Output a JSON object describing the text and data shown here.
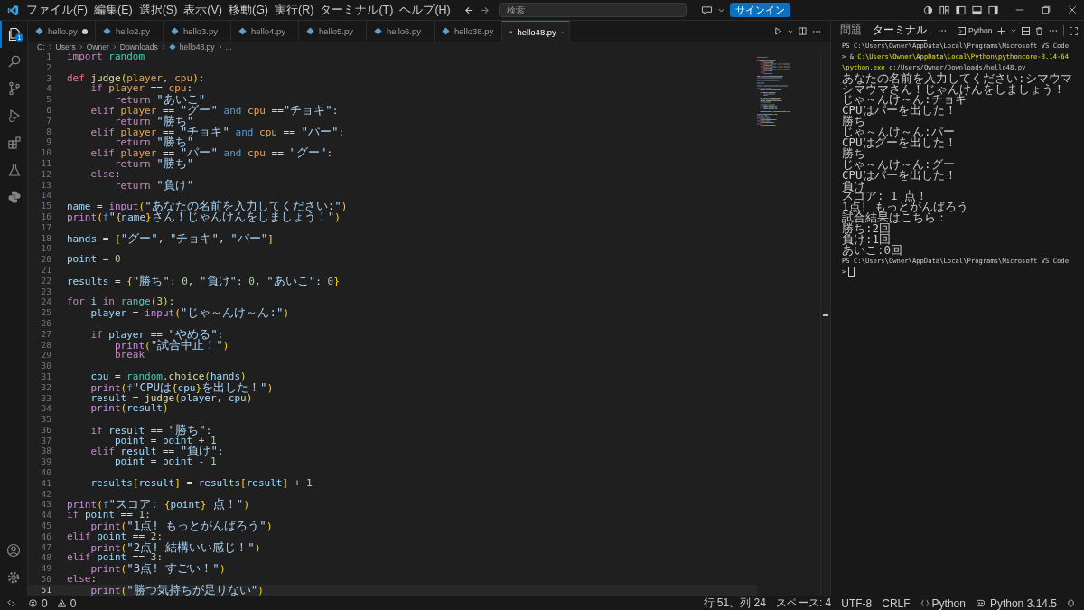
{
  "menu": [
    "ファイル(F)",
    "編集(E)",
    "選択(S)",
    "表示(V)",
    "移動(G)",
    "実行(R)",
    "ターミナル(T)",
    "ヘルプ(H)"
  ],
  "search": {
    "placeholder": "検索"
  },
  "signin_button": "サインイン",
  "activity_bar": {
    "items": [
      {
        "kind": "explorer",
        "selected": true,
        "badge": "1"
      },
      {
        "kind": "search",
        "selected": false
      },
      {
        "kind": "scm",
        "selected": false
      },
      {
        "kind": "debug",
        "selected": false
      },
      {
        "kind": "extensions",
        "selected": false
      },
      {
        "kind": "testing",
        "selected": false
      },
      {
        "kind": "python",
        "selected": false
      }
    ]
  },
  "tabs": [
    {
      "label": "hello.py",
      "selected": false,
      "modified": true
    },
    {
      "label": "hello2.py",
      "selected": false,
      "modified": false
    },
    {
      "label": "hello3.py",
      "selected": false,
      "modified": false
    },
    {
      "label": "hello4.py",
      "selected": false,
      "modified": false
    },
    {
      "label": "hello5.py",
      "selected": false,
      "modified": false
    },
    {
      "label": "hello6.py",
      "selected": false,
      "modified": false
    },
    {
      "label": "hello38.py",
      "selected": false,
      "modified": false
    },
    {
      "label": "hello48.py",
      "selected": true,
      "modified": false
    }
  ],
  "breadcrumb": [
    {
      "kind": "folder",
      "text": "C:"
    },
    {
      "kind": "folder",
      "text": "Users"
    },
    {
      "kind": "folder",
      "text": "Owner"
    },
    {
      "kind": "folder",
      "text": "Downloads"
    },
    {
      "kind": "file",
      "text": "hello48.py"
    },
    {
      "kind": "more",
      "text": "..."
    }
  ],
  "editor": {
    "lines": [
      {
        "number": "1",
        "current": false,
        "tokens": [
          {
            "kind": "kw",
            "text": "import "
          },
          {
            "kind": "cls",
            "text": "random"
          }
        ]
      },
      {
        "number": "2",
        "current": false
      },
      {
        "number": "3",
        "current": false,
        "tokens": [
          {
            "kind": "def",
            "text": "def "
          },
          {
            "kind": "fn",
            "text": "judge"
          },
          {
            "kind": "br",
            "text": "("
          },
          {
            "kind": "param",
            "text": "player"
          },
          {
            "kind": "op",
            "text": ", "
          },
          {
            "kind": "param",
            "text": "cpu"
          },
          {
            "kind": "br",
            "text": ")"
          },
          {
            "kind": "op",
            "text": ":"
          }
        ]
      },
      {
        "number": "4",
        "current": false,
        "tokens": [
          {
            "kind": "kw",
            "text": "    if "
          },
          {
            "kind": "param",
            "text": "player"
          },
          {
            "kind": "op",
            "text": " == "
          },
          {
            "kind": "param",
            "text": "cpu"
          },
          {
            "kind": "op",
            "text": ":"
          }
        ]
      },
      {
        "number": "5",
        "current": false,
        "tokens": [
          {
            "kind": "kw",
            "text": "        return "
          },
          {
            "kind": "str",
            "text": "\"あいこ\""
          }
        ]
      },
      {
        "number": "6",
        "current": false,
        "tokens": [
          {
            "kind": "kw",
            "text": "    elif "
          },
          {
            "kind": "param",
            "text": "player"
          },
          {
            "kind": "op",
            "text": " == "
          },
          {
            "kind": "str",
            "text": "\"グー\""
          },
          {
            "kind": "logic",
            "text": " and "
          },
          {
            "kind": "param",
            "text": "cpu"
          },
          {
            "kind": "op",
            "text": " =="
          },
          {
            "kind": "str",
            "text": "\"チョキ\""
          },
          {
            "kind": "op",
            "text": ":"
          }
        ]
      },
      {
        "number": "7",
        "current": false,
        "tokens": [
          {
            "kind": "kw",
            "text": "        return "
          },
          {
            "kind": "str",
            "text": "\"勝ち\""
          }
        ]
      },
      {
        "number": "8",
        "current": false,
        "tokens": [
          {
            "kind": "kw",
            "text": "    elif "
          },
          {
            "kind": "param",
            "text": "player"
          },
          {
            "kind": "op",
            "text": " == "
          },
          {
            "kind": "str",
            "text": "\"チョキ\""
          },
          {
            "kind": "logic",
            "text": " and "
          },
          {
            "kind": "param",
            "text": "cpu"
          },
          {
            "kind": "op",
            "text": " == "
          },
          {
            "kind": "str",
            "text": "\"パー\""
          },
          {
            "kind": "op",
            "text": ":"
          }
        ]
      },
      {
        "number": "9",
        "current": false,
        "tokens": [
          {
            "kind": "kw",
            "text": "        return "
          },
          {
            "kind": "str",
            "text": "\"勝ち\""
          }
        ]
      },
      {
        "number": "10",
        "current": false,
        "tokens": [
          {
            "kind": "kw",
            "text": "    elif "
          },
          {
            "kind": "param",
            "text": "player"
          },
          {
            "kind": "op",
            "text": " == "
          },
          {
            "kind": "str",
            "text": "\"パー\""
          },
          {
            "kind": "logic",
            "text": " and "
          },
          {
            "kind": "param",
            "text": "cpu"
          },
          {
            "kind": "op",
            "text": " == "
          },
          {
            "kind": "str",
            "text": "\"グー\""
          },
          {
            "kind": "op",
            "text": ":"
          }
        ]
      },
      {
        "number": "11",
        "current": false,
        "tokens": [
          {
            "kind": "kw",
            "text": "        return "
          },
          {
            "kind": "str",
            "text": "\"勝ち\""
          }
        ]
      },
      {
        "number": "12",
        "current": false,
        "tokens": [
          {
            "kind": "kw",
            "text": "    else"
          },
          {
            "kind": "op",
            "text": ":"
          }
        ]
      },
      {
        "number": "13",
        "current": false,
        "tokens": [
          {
            "kind": "kw",
            "text": "        return "
          },
          {
            "kind": "str",
            "text": "\"負け\""
          }
        ]
      },
      {
        "number": "14",
        "current": false
      },
      {
        "number": "15",
        "current": false,
        "tokens": [
          {
            "kind": "var",
            "text": "name"
          },
          {
            "kind": "op",
            "text": " = "
          },
          {
            "kind": "builtin",
            "text": "input"
          },
          {
            "kind": "br",
            "text": "("
          },
          {
            "kind": "str",
            "text": "\"あなたの名前を入力してください:\""
          },
          {
            "kind": "br",
            "text": ")"
          }
        ]
      },
      {
        "number": "16",
        "current": false,
        "tokens": [
          {
            "kind": "builtin",
            "text": "print"
          },
          {
            "kind": "br",
            "text": "("
          },
          {
            "kind": "logic",
            "text": "f"
          },
          {
            "kind": "str",
            "text": "\""
          },
          {
            "kind": "br",
            "text": "{"
          },
          {
            "kind": "var",
            "text": "name"
          },
          {
            "kind": "br",
            "text": "}"
          },
          {
            "kind": "str",
            "text": "さん！じゃんけんをしましょう！\""
          },
          {
            "kind": "br",
            "text": ")"
          }
        ]
      },
      {
        "number": "17",
        "current": false
      },
      {
        "number": "18",
        "current": false,
        "tokens": [
          {
            "kind": "var",
            "text": "hands"
          },
          {
            "kind": "op",
            "text": " = "
          },
          {
            "kind": "br",
            "text": "["
          },
          {
            "kind": "str",
            "text": "\"グー\""
          },
          {
            "kind": "op",
            "text": ", "
          },
          {
            "kind": "str",
            "text": "\"チョキ\""
          },
          {
            "kind": "op",
            "text": ", "
          },
          {
            "kind": "str",
            "text": "\"パー\""
          },
          {
            "kind": "br",
            "text": "]"
          }
        ]
      },
      {
        "number": "19",
        "current": false
      },
      {
        "number": "20",
        "current": false,
        "tokens": [
          {
            "kind": "var",
            "text": "point"
          },
          {
            "kind": "op",
            "text": " = "
          },
          {
            "kind": "num",
            "text": "0"
          }
        ]
      },
      {
        "number": "21",
        "current": false
      },
      {
        "number": "22",
        "current": false,
        "tokens": [
          {
            "kind": "var",
            "text": "results"
          },
          {
            "kind": "op",
            "text": " = "
          },
          {
            "kind": "br",
            "text": "{"
          },
          {
            "kind": "str",
            "text": "\"勝ち\""
          },
          {
            "kind": "op",
            "text": ": "
          },
          {
            "kind": "num",
            "text": "0"
          },
          {
            "kind": "op",
            "text": ", "
          },
          {
            "kind": "str",
            "text": "\"負け\""
          },
          {
            "kind": "op",
            "text": ": "
          },
          {
            "kind": "num",
            "text": "0"
          },
          {
            "kind": "op",
            "text": ", "
          },
          {
            "kind": "str",
            "text": "\"あいこ\""
          },
          {
            "kind": "op",
            "text": ": "
          },
          {
            "kind": "num",
            "text": "0"
          },
          {
            "kind": "br",
            "text": "}"
          }
        ]
      },
      {
        "number": "23",
        "current": false
      },
      {
        "number": "24",
        "current": false,
        "tokens": [
          {
            "kind": "kw",
            "text": "for "
          },
          {
            "kind": "var",
            "text": "i"
          },
          {
            "kind": "kw",
            "text": " in "
          },
          {
            "kind": "cls",
            "text": "range"
          },
          {
            "kind": "br",
            "text": "("
          },
          {
            "kind": "num",
            "text": "3"
          },
          {
            "kind": "br",
            "text": ")"
          },
          {
            "kind": "op",
            "text": ":"
          }
        ]
      },
      {
        "number": "25",
        "current": false,
        "tokens": [
          {
            "kind": "var",
            "text": "    player"
          },
          {
            "kind": "op",
            "text": " = "
          },
          {
            "kind": "builtin",
            "text": "input"
          },
          {
            "kind": "br",
            "text": "("
          },
          {
            "kind": "str",
            "text": "\"じゃ～んけ～ん:\""
          },
          {
            "kind": "br",
            "text": ")"
          }
        ]
      },
      {
        "number": "26",
        "current": false
      },
      {
        "number": "27",
        "current": false,
        "tokens": [
          {
            "kind": "kw",
            "text": "    if "
          },
          {
            "kind": "var",
            "text": "player"
          },
          {
            "kind": "op",
            "text": " == "
          },
          {
            "kind": "str",
            "text": "\"やめる\""
          },
          {
            "kind": "op",
            "text": ":"
          }
        ]
      },
      {
        "number": "28",
        "current": false,
        "tokens": [
          {
            "kind": "builtin",
            "text": "        print"
          },
          {
            "kind": "br",
            "text": "("
          },
          {
            "kind": "str",
            "text": "\"試合中止！\""
          },
          {
            "kind": "br",
            "text": ")"
          }
        ]
      },
      {
        "number": "29",
        "current": false,
        "tokens": [
          {
            "kind": "kw",
            "text": "        break"
          }
        ]
      },
      {
        "number": "30",
        "current": false
      },
      {
        "number": "31",
        "current": false,
        "tokens": [
          {
            "kind": "var",
            "text": "    cpu"
          },
          {
            "kind": "op",
            "text": " = "
          },
          {
            "kind": "cls",
            "text": "random"
          },
          {
            "kind": "op",
            "text": "."
          },
          {
            "kind": "fn",
            "text": "choice"
          },
          {
            "kind": "br",
            "text": "("
          },
          {
            "kind": "var",
            "text": "hands"
          },
          {
            "kind": "br",
            "text": ")"
          }
        ]
      },
      {
        "number": "32",
        "current": false,
        "tokens": [
          {
            "kind": "builtin",
            "text": "    print"
          },
          {
            "kind": "br",
            "text": "("
          },
          {
            "kind": "logic",
            "text": "f"
          },
          {
            "kind": "str",
            "text": "\"CPUは"
          },
          {
            "kind": "br",
            "text": "{"
          },
          {
            "kind": "var",
            "text": "cpu"
          },
          {
            "kind": "br",
            "text": "}"
          },
          {
            "kind": "str",
            "text": "を出した！\""
          },
          {
            "kind": "br",
            "text": ")"
          }
        ]
      },
      {
        "number": "33",
        "current": false,
        "tokens": [
          {
            "kind": "var",
            "text": "    result"
          },
          {
            "kind": "op",
            "text": " = "
          },
          {
            "kind": "fn",
            "text": "judge"
          },
          {
            "kind": "br",
            "text": "("
          },
          {
            "kind": "var",
            "text": "player"
          },
          {
            "kind": "op",
            "text": ", "
          },
          {
            "kind": "var",
            "text": "cpu"
          },
          {
            "kind": "br",
            "text": ")"
          }
        ]
      },
      {
        "number": "34",
        "current": false,
        "tokens": [
          {
            "kind": "builtin",
            "text": "    print"
          },
          {
            "kind": "br",
            "text": "("
          },
          {
            "kind": "var",
            "text": "result"
          },
          {
            "kind": "br",
            "text": ")"
          }
        ]
      },
      {
        "number": "35",
        "current": false
      },
      {
        "number": "36",
        "current": false,
        "tokens": [
          {
            "kind": "kw",
            "text": "    if "
          },
          {
            "kind": "var",
            "text": "result"
          },
          {
            "kind": "op",
            "text": " == "
          },
          {
            "kind": "str",
            "text": "\"勝ち\""
          },
          {
            "kind": "op",
            "text": ":"
          }
        ]
      },
      {
        "number": "37",
        "current": false,
        "tokens": [
          {
            "kind": "var",
            "text": "        point"
          },
          {
            "kind": "op",
            "text": " = "
          },
          {
            "kind": "var",
            "text": "point"
          },
          {
            "kind": "op",
            "text": " + "
          },
          {
            "kind": "num",
            "text": "1"
          }
        ]
      },
      {
        "number": "38",
        "current": false,
        "tokens": [
          {
            "kind": "kw",
            "text": "    elif "
          },
          {
            "kind": "var",
            "text": "result"
          },
          {
            "kind": "op",
            "text": " == "
          },
          {
            "kind": "str",
            "text": "\"負け\""
          },
          {
            "kind": "op",
            "text": ":"
          }
        ]
      },
      {
        "number": "39",
        "current": false,
        "tokens": [
          {
            "kind": "var",
            "text": "        point"
          },
          {
            "kind": "op",
            "text": " = "
          },
          {
            "kind": "var",
            "text": "point"
          },
          {
            "kind": "op",
            "text": " - "
          },
          {
            "kind": "num",
            "text": "1"
          }
        ]
      },
      {
        "number": "40",
        "current": false
      },
      {
        "number": "41",
        "current": false,
        "tokens": [
          {
            "kind": "var",
            "text": "    results"
          },
          {
            "kind": "br",
            "text": "["
          },
          {
            "kind": "var",
            "text": "result"
          },
          {
            "kind": "br",
            "text": "]"
          },
          {
            "kind": "op",
            "text": " = "
          },
          {
            "kind": "var",
            "text": "results"
          },
          {
            "kind": "br",
            "text": "["
          },
          {
            "kind": "var",
            "text": "result"
          },
          {
            "kind": "br",
            "text": "]"
          },
          {
            "kind": "op",
            "text": " + "
          },
          {
            "kind": "num",
            "text": "1"
          }
        ]
      },
      {
        "number": "42",
        "current": false
      },
      {
        "number": "43",
        "current": false,
        "tokens": [
          {
            "kind": "builtin",
            "text": "print"
          },
          {
            "kind": "br",
            "text": "("
          },
          {
            "kind": "logic",
            "text": "f"
          },
          {
            "kind": "str",
            "text": "\"スコア: "
          },
          {
            "kind": "br",
            "text": "{"
          },
          {
            "kind": "var",
            "text": "point"
          },
          {
            "kind": "br",
            "text": "}"
          },
          {
            "kind": "str",
            "text": " 点！\""
          },
          {
            "kind": "br",
            "text": ")"
          }
        ]
      },
      {
        "number": "44",
        "current": false,
        "tokens": [
          {
            "kind": "kw",
            "text": "if "
          },
          {
            "kind": "var",
            "text": "point"
          },
          {
            "kind": "op",
            "text": " == "
          },
          {
            "kind": "num",
            "text": "1"
          },
          {
            "kind": "op",
            "text": ":"
          }
        ]
      },
      {
        "number": "45",
        "current": false,
        "tokens": [
          {
            "kind": "builtin",
            "text": "    print"
          },
          {
            "kind": "br",
            "text": "("
          },
          {
            "kind": "str",
            "text": "\"1点! もっとがんばろう\""
          },
          {
            "kind": "br",
            "text": ")"
          }
        ]
      },
      {
        "number": "46",
        "current": false,
        "tokens": [
          {
            "kind": "kw",
            "text": "elif "
          },
          {
            "kind": "var",
            "text": "point"
          },
          {
            "kind": "op",
            "text": " == "
          },
          {
            "kind": "num",
            "text": "2"
          },
          {
            "kind": "op",
            "text": ":"
          }
        ]
      },
      {
        "number": "47",
        "current": false,
        "tokens": [
          {
            "kind": "builtin",
            "text": "    print"
          },
          {
            "kind": "br",
            "text": "("
          },
          {
            "kind": "str",
            "text": "\"2点! 結構いい感じ！\""
          },
          {
            "kind": "br",
            "text": ")"
          }
        ]
      },
      {
        "number": "48",
        "current": false,
        "tokens": [
          {
            "kind": "kw",
            "text": "elif "
          },
          {
            "kind": "var",
            "text": "point"
          },
          {
            "kind": "op",
            "text": " == "
          },
          {
            "kind": "num",
            "text": "3"
          },
          {
            "kind": "op",
            "text": ":"
          }
        ]
      },
      {
        "number": "49",
        "current": false,
        "tokens": [
          {
            "kind": "builtin",
            "text": "    print"
          },
          {
            "kind": "br",
            "text": "("
          },
          {
            "kind": "str",
            "text": "\"3点! すごい！\""
          },
          {
            "kind": "br",
            "text": ")"
          }
        ]
      },
      {
        "number": "50",
        "current": false,
        "tokens": [
          {
            "kind": "kw",
            "text": "else"
          },
          {
            "kind": "op",
            "text": ":"
          }
        ]
      },
      {
        "number": "51",
        "current": true,
        "tokens": [
          {
            "kind": "builtin",
            "text": "    print"
          },
          {
            "kind": "br",
            "text": "("
          },
          {
            "kind": "str",
            "text": "\"勝つ気持ちが足りない\""
          },
          {
            "kind": "br",
            "text": ")"
          }
        ]
      }
    ]
  },
  "panel": {
    "tabs": [
      {
        "label": "問題",
        "selected": false
      },
      {
        "label": "ターミナル",
        "selected": true
      }
    ],
    "terminal_name": "Python",
    "terminal": {
      "cursor": true,
      "lines": [
        {
          "kind": "prompt",
          "tokens": [
            {
              "kind": "plain",
              "text": "PS C:\\Users\\Owner\\AppData\\Local\\Programs\\Microsoft VS Code"
            }
          ]
        },
        {
          "kind": "prompt",
          "tokens": [
            {
              "kind": "plain",
              "text": "> & "
            },
            {
              "kind": "cmd",
              "text": "C:\\Users\\Owner\\AppData\\Local\\Python\\pythoncore-3.14-64"
            }
          ]
        },
        {
          "kind": "prompt",
          "tokens": [
            {
              "kind": "cmd",
              "text": "\\python.exe"
            },
            {
              "kind": "plain",
              "text": " c:/Users/Owner/Downloads/hello48.py"
            }
          ]
        },
        {
          "kind": "output",
          "tokens": [
            {
              "kind": "plain",
              "text": "あなたの名前を入力してください:シマウマ"
            }
          ]
        },
        {
          "kind": "output",
          "tokens": [
            {
              "kind": "plain",
              "text": "シマウマさん！じゃんけんをしましょう！"
            }
          ]
        },
        {
          "kind": "output",
          "tokens": [
            {
              "kind": "plain",
              "text": "じゃ～んけ～ん:チョキ"
            }
          ]
        },
        {
          "kind": "output",
          "tokens": [
            {
              "kind": "plain",
              "text": "CPUはパーを出した！"
            }
          ]
        },
        {
          "kind": "output",
          "tokens": [
            {
              "kind": "plain",
              "text": "勝ち"
            }
          ]
        },
        {
          "kind": "output",
          "tokens": [
            {
              "kind": "plain",
              "text": "じゃ～んけ～ん:パー"
            }
          ]
        },
        {
          "kind": "output",
          "tokens": [
            {
              "kind": "plain",
              "text": "CPUはグーを出した！"
            }
          ]
        },
        {
          "kind": "output",
          "tokens": [
            {
              "kind": "plain",
              "text": "勝ち"
            }
          ]
        },
        {
          "kind": "output",
          "tokens": [
            {
              "kind": "plain",
              "text": "じゃ～んけ～ん:グー"
            }
          ]
        },
        {
          "kind": "output",
          "tokens": [
            {
              "kind": "plain",
              "text": "CPUはパーを出した！"
            }
          ]
        },
        {
          "kind": "output",
          "tokens": [
            {
              "kind": "plain",
              "text": "負け"
            }
          ]
        },
        {
          "kind": "output",
          "tokens": [
            {
              "kind": "plain",
              "text": "スコア: 1 点！"
            }
          ]
        },
        {
          "kind": "output",
          "tokens": [
            {
              "kind": "plain",
              "text": "1点! もっとがんばろう"
            }
          ]
        },
        {
          "kind": "output",
          "tokens": [
            {
              "kind": "plain",
              "text": "試合結果はこちら："
            }
          ]
        },
        {
          "kind": "output",
          "tokens": [
            {
              "kind": "plain",
              "text": "勝ち:2回"
            }
          ]
        },
        {
          "kind": "output",
          "tokens": [
            {
              "kind": "plain",
              "text": "負け:1回"
            }
          ]
        },
        {
          "kind": "output",
          "tokens": [
            {
              "kind": "plain",
              "text": "あいこ:0回"
            }
          ]
        },
        {
          "kind": "prompt",
          "tokens": [
            {
              "kind": "plain",
              "text": "PS C:\\Users\\Owner\\AppData\\Local\\Programs\\Microsoft VS Code"
            }
          ]
        },
        {
          "kind": "prompt",
          "tokens": [
            {
              "kind": "plain",
              "text": ">"
            }
          ]
        }
      ]
    }
  },
  "status_bar": {
    "errors": "0",
    "warnings": "0",
    "items": [
      "行 51、列 24",
      "スペース: 4",
      "UTF-8",
      "CRLF"
    ],
    "language": "Python",
    "interpreter": "Python 3.14.5"
  }
}
